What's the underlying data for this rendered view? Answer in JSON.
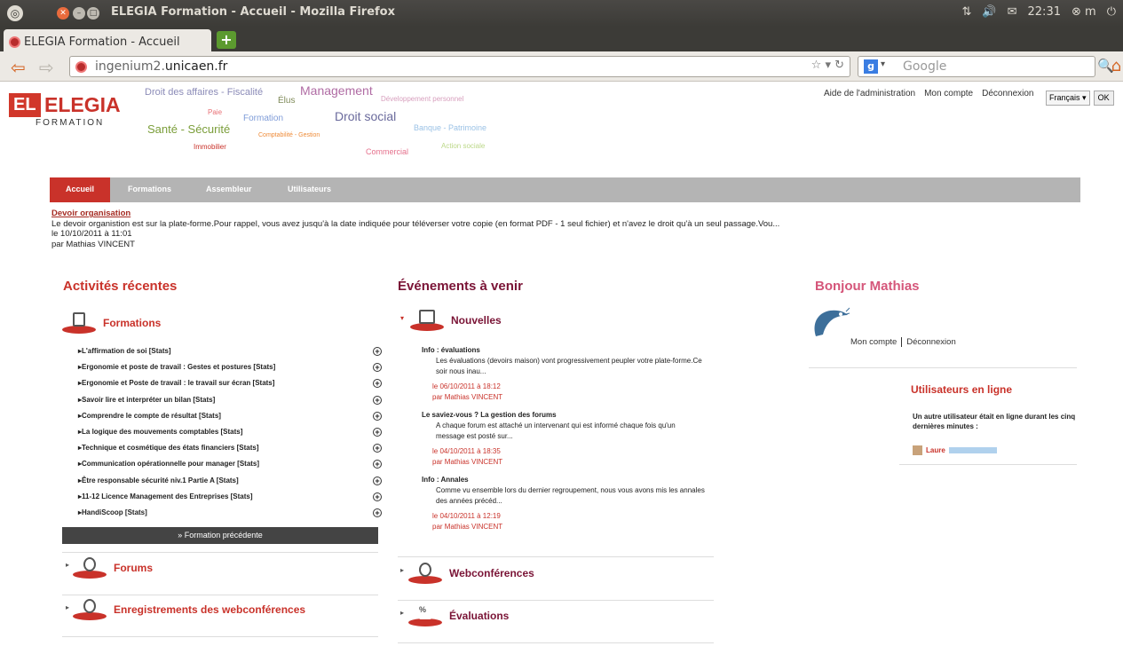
{
  "window": {
    "title": "ELEGIA Formation - Accueil - Mozilla Firefox",
    "clock": "22:31",
    "user_short": "m"
  },
  "browser": {
    "tab_label": "ELEGIA Formation - Accueil",
    "url_prefix": "ingenium2.",
    "url_domain": "unicaen.fr",
    "search_placeholder": "Google"
  },
  "logo": {
    "mark": "EL",
    "name": "ELEGIA",
    "sub": "FORMATION"
  },
  "tag_cloud": [
    "Droit des affaires - Fiscalité",
    "Élus",
    "Management",
    "Développement personnel",
    "Paie",
    "Formation",
    "Droit social",
    "Santé - Sécurité",
    "Comptabilité - Gestion",
    "Banque - Patrimoine",
    "Immobilier",
    "Action sociale",
    "Commercial"
  ],
  "toplinks": {
    "admin": "Aide de l'administration",
    "account": "Mon compte",
    "logout": "Déconnexion"
  },
  "language": {
    "selected": "Français",
    "ok": "OK"
  },
  "menu": [
    "Accueil",
    "Formations",
    "Assembleur",
    "Utilisateurs"
  ],
  "notice": {
    "title": "Devoir organisation",
    "body": "Le devoir organistion est sur la plate-forme.Pour rappel, vous avez jusqu'à la date indiquée pour téléverser votre copie (en format PDF - 1 seul fichier) et n'avez le droit qu'à un seul passage.Vou...",
    "date": "le 10/10/2011 à 11:01",
    "author": "par Mathias VINCENT"
  },
  "activity": {
    "title": "Activités récentes",
    "formations_title": "Formations",
    "formations": [
      "L'affirmation de soi [Stats]",
      "Ergonomie et poste de travail : Gestes et postures [Stats]",
      "Ergonomie et Poste de travail : le travail sur écran [Stats]",
      "Savoir lire et interpréter un bilan [Stats]",
      "Comprendre le compte de résultat [Stats]",
      "La logique des mouvements comptables [Stats]",
      "Technique et cosmétique des états financiers [Stats]",
      "Communication opérationnelle pour manager [Stats]",
      "Être responsable sécurité niv.1 Partie A [Stats]",
      "11-12 Licence Management des Entreprises [Stats]",
      "HandiScoop [Stats]"
    ],
    "prev_button": "» Formation précédente",
    "forums": "Forums",
    "recordings": "Enregistrements des webconférences"
  },
  "events": {
    "title": "Événements à venir",
    "news_title": "Nouvelles",
    "items": [
      {
        "head": "Info : évaluations",
        "body": "Les évaluations (devoirs maison) vont progressivement peupler votre plate-forme.Ce soir nous inau...",
        "date": "le 06/10/2011 à 18:12",
        "author": "par Mathias VINCENT"
      },
      {
        "head": "Le saviez-vous ? La gestion des forums",
        "body": "A chaque forum est attaché un intervenant qui est informé chaque fois qu'un message est posté sur...",
        "date": "le 04/10/2011 à 18:35",
        "author": "par Mathias VINCENT"
      },
      {
        "head": "Info : Annales",
        "body": "Comme vu ensemble lors du dernier regroupement, nous vous avons mis les annales des années précéd...",
        "date": "le 04/10/2011 à 12:19",
        "author": "par Mathias VINCENT"
      }
    ],
    "webconf": "Webconférences",
    "evaluations": "Évaluations"
  },
  "profile": {
    "greeting": "Bonjour Mathias",
    "account": "Mon compte",
    "logout": "Déconnexion",
    "online_title": "Utilisateurs en ligne",
    "online_text": "Un autre utilisateur était en ligne durant les cinq dernières minutes :",
    "online_user": "Laure"
  }
}
